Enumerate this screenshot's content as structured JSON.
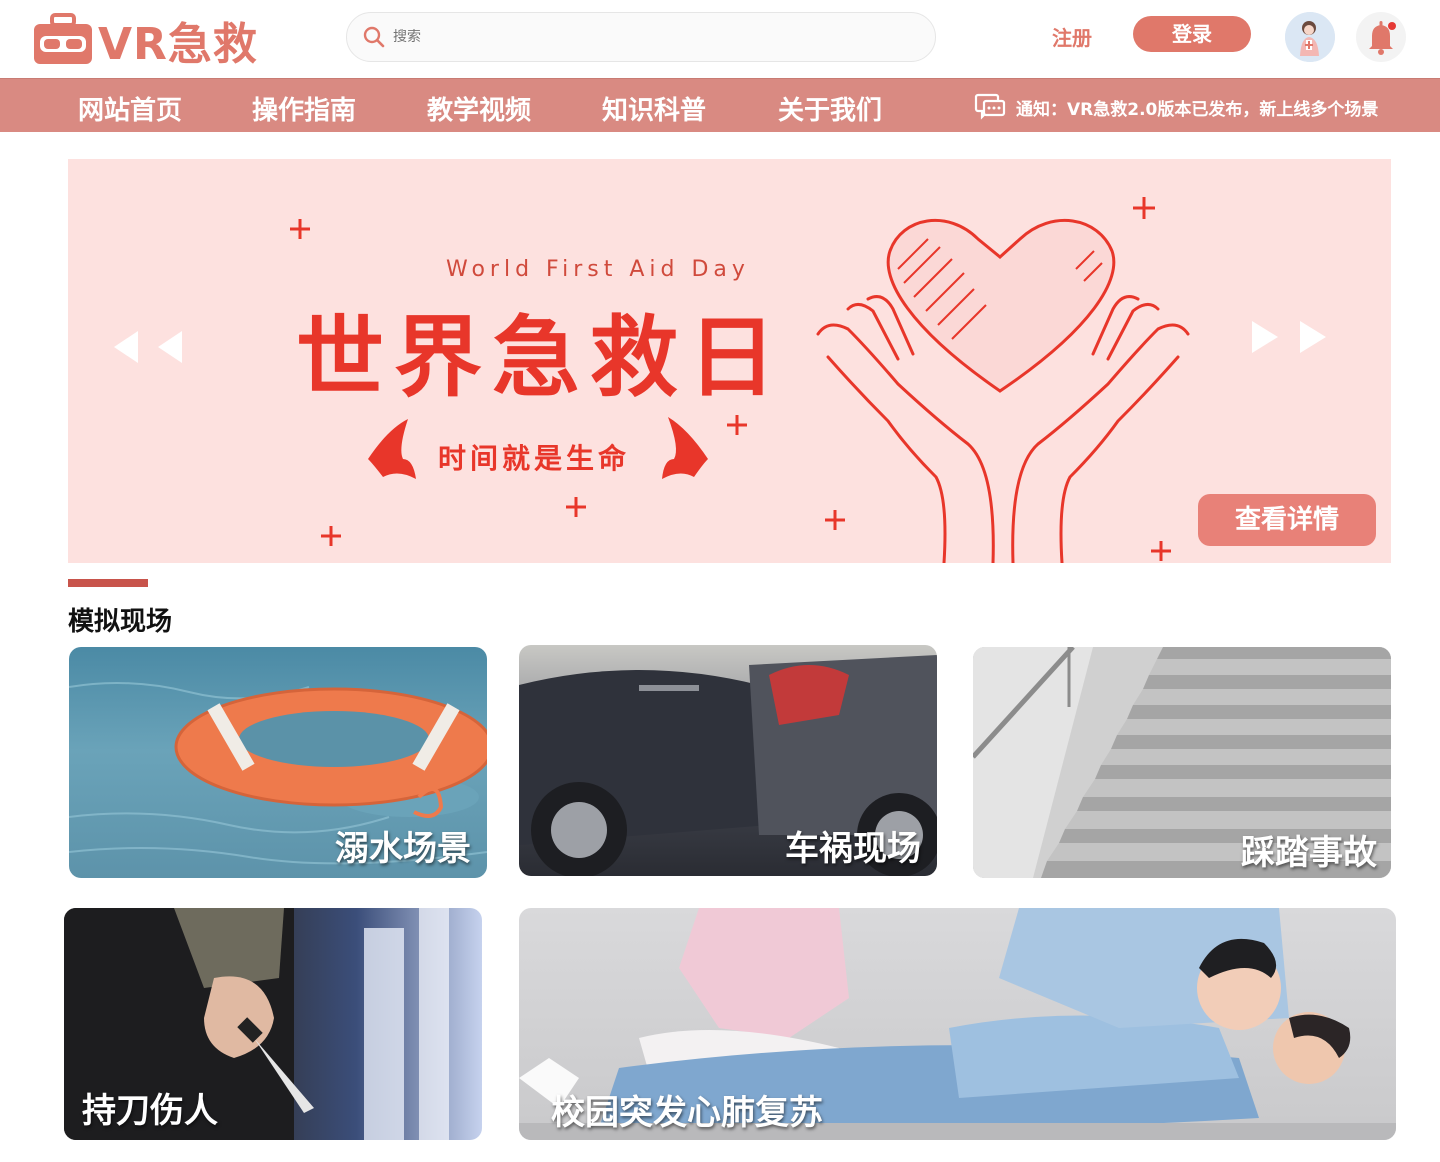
{
  "header": {
    "logo_text": "VR急救",
    "search_placeholder": "搜索",
    "register_label": "注册",
    "login_label": "登录"
  },
  "nav": {
    "items": [
      {
        "label": "网站首页"
      },
      {
        "label": "操作指南"
      },
      {
        "label": "教学视频"
      },
      {
        "label": "知识科普"
      },
      {
        "label": "关于我们"
      }
    ],
    "notice": "通知：VR急救2.0版本已发布，新上线多个场景"
  },
  "banner": {
    "subtitle_en": "World First Aid Day",
    "title": "世界急救日",
    "slogan": "时间就是生命",
    "detail_button": "查看详情"
  },
  "section": {
    "title": "模拟现场"
  },
  "scenes": [
    {
      "label": "溺水场景"
    },
    {
      "label": "车祸现场"
    },
    {
      "label": "踩踏事故"
    },
    {
      "label": "持刀伤人"
    },
    {
      "label": "校园突发心肺复苏"
    }
  ],
  "colors": {
    "brand": "#e0786a",
    "nav_bg": "#d98a82",
    "banner_bg": "#fde1df",
    "banner_red": "#e8362a"
  }
}
